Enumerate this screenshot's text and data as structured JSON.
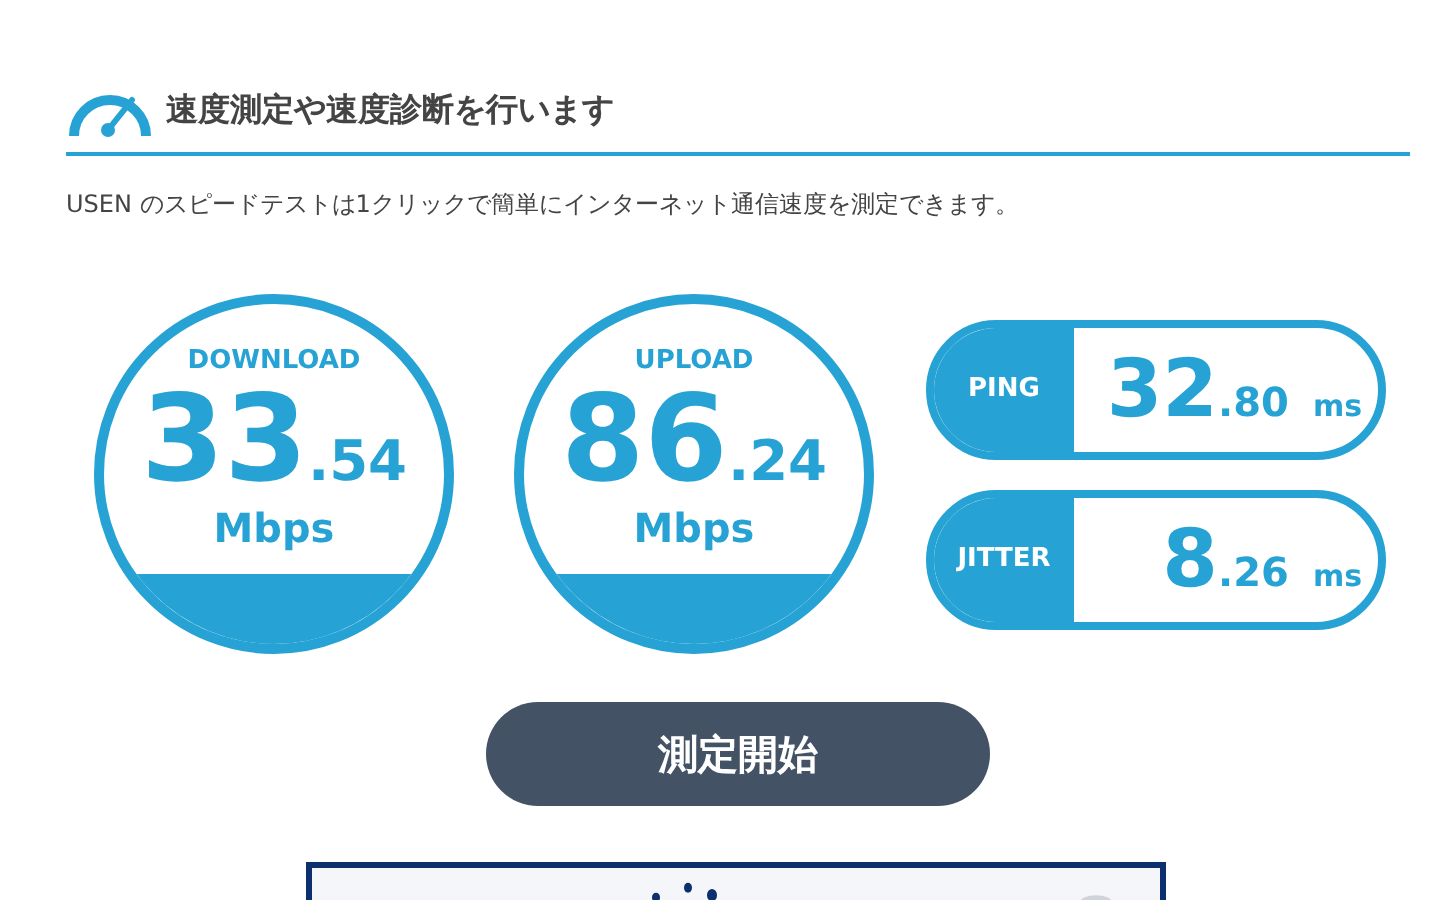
{
  "header": {
    "title": "速度測定や速度診断を行います"
  },
  "description": "USEN のスピードテストは1クリックで簡単にインターネット通信速度を測定できます。",
  "gauges": [
    {
      "label": "DOWNLOAD",
      "integer": "33",
      "decimal": ".54",
      "unit": "Mbps"
    },
    {
      "label": "UPLOAD",
      "integer": "86",
      "decimal": ".24",
      "unit": "Mbps"
    }
  ],
  "metrics": [
    {
      "label": "PING",
      "integer": "32",
      "decimal": ".80",
      "unit": "ms"
    },
    {
      "label": "JITTER",
      "integer": "8",
      "decimal": ".26",
      "unit": "ms"
    }
  ],
  "start_button": "測定開始"
}
